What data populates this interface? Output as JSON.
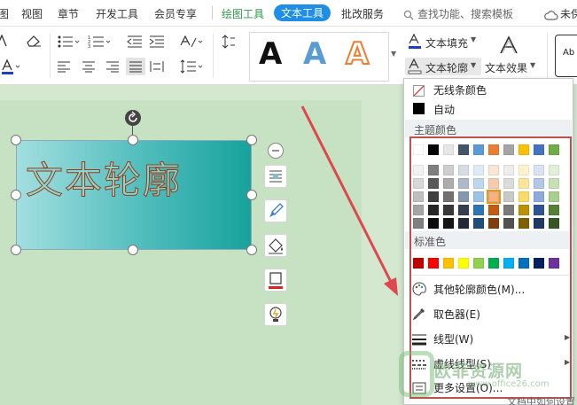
{
  "menu": {
    "items": [
      "图",
      "视图",
      "章节",
      "开发工具",
      "会员专享"
    ],
    "drawing_tools": "绘图工具",
    "text_tools": "文本工具",
    "review_service": "批改服务",
    "search_text": "查找功能、搜索模板",
    "cloud_text": "未保"
  },
  "ribbon": {
    "text_fill_label": "文本填充",
    "text_outline_label": "文本轮廓",
    "text_effect_label": "文本效果",
    "wordart_letter": "A",
    "style_preview_text": "Ab",
    "text_fill_color": "#1f3fbf",
    "font_color": "#1f3fbf"
  },
  "canvas": {
    "art_text": "文本轮廓"
  },
  "dropdown": {
    "no_line_label": "无线条颜色",
    "auto_label": "自动",
    "theme_colors_label": "主题颜色",
    "standard_colors_label": "标准色",
    "more_colors_label": "其他轮廓颜色(M)...",
    "eyedropper_label": "取色器(E)",
    "line_style_label": "线型(W)",
    "dash_style_label": "虚线线型(S)",
    "more_settings_label": "更多设置(O)...",
    "theme_top_row": [
      "#ffffff",
      "#000000",
      "#e7e6e6",
      "#44546a",
      "#5b9bd5",
      "#ed7d31",
      "#a5a5a5",
      "#ffc000",
      "#4472c4",
      "#70ad47"
    ],
    "theme_shades": [
      [
        "#f2f2f2",
        "#7f7f7f",
        "#d0cece",
        "#d6dce4",
        "#deebf6",
        "#fbe4d5",
        "#ededed",
        "#fff2cc",
        "#dae3f3",
        "#e2efd9"
      ],
      [
        "#d8d8d8",
        "#595959",
        "#aeabab",
        "#adb9ca",
        "#bdd7ee",
        "#f8cbad",
        "#dbdbdb",
        "#ffe598",
        "#b4c7e7",
        "#c5e0b3"
      ],
      [
        "#bfbfbf",
        "#3f3f3f",
        "#757070",
        "#8496b0",
        "#9cc3e5",
        "#f4b183",
        "#c9c9c9",
        "#ffd965",
        "#8eaadb",
        "#a8d08d"
      ],
      [
        "#a5a5a5",
        "#262626",
        "#3a3838",
        "#333f4f",
        "#2e75b5",
        "#c55a11",
        "#7b7b7b",
        "#bf9000",
        "#2f5496",
        "#538135"
      ],
      [
        "#7f7f7f",
        "#0c0c0c",
        "#171616",
        "#222a35",
        "#1e4e79",
        "#833c0b",
        "#525252",
        "#7f6000",
        "#203864",
        "#375623"
      ]
    ],
    "standard_colors": [
      "#c00000",
      "#ff0000",
      "#ffc000",
      "#ffff00",
      "#92d050",
      "#00b050",
      "#00b0f0",
      "#0070c0",
      "#002060",
      "#7030a0"
    ],
    "selected_swatch": "row 3, column 6"
  },
  "watermark": {
    "brand": "欧菲资源网",
    "site": "www.office26.com"
  },
  "bottom_right_text": "文档中如何设置"
}
